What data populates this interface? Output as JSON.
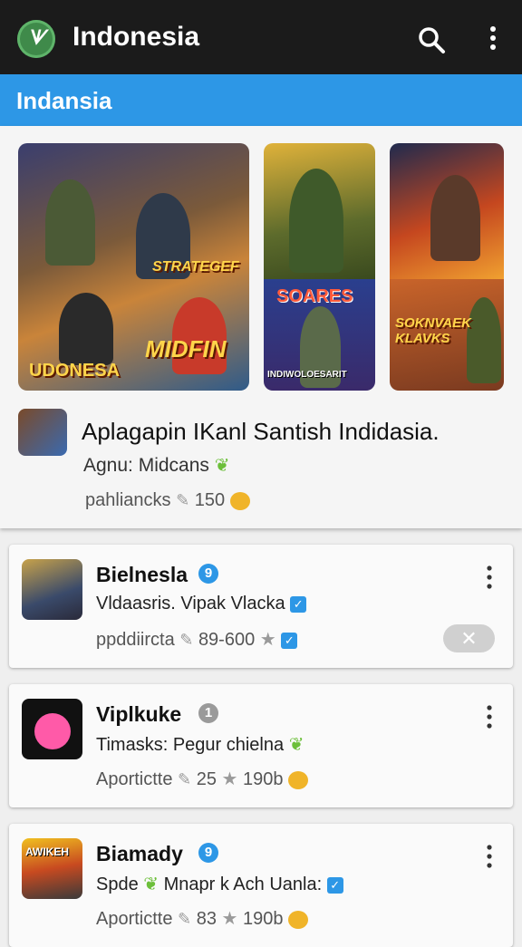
{
  "app_bar": {
    "title": "Indonesia",
    "logo_text": "ᗐ",
    "search_icon": "search-icon",
    "menu_icon": "more-vert-icon"
  },
  "section": {
    "title": "Indansia"
  },
  "featured": {
    "banners": [
      {
        "label_top": "STRATEGEF",
        "label_mid": "MIDFIN",
        "label_bottom": "UDONESA"
      },
      {
        "label_top": "SOARES",
        "label_bottom": "INDIWOLOESARIT"
      },
      {
        "label": "SOKNVAEK KLAVKS"
      }
    ],
    "title": "Aplagapin IKanl Santish Indidasia.",
    "subtitle": "Agnu: Midcans",
    "meta_label": "pahliancks",
    "meta_count": "150"
  },
  "cards": [
    {
      "title": "Bielnesla",
      "badge": "9",
      "subtitle": "Vldaasris. Vipak Vlacka",
      "meta_label": "ppddiircta",
      "meta_value": "89-600",
      "dismiss": "✕"
    },
    {
      "title": "Viplkuke",
      "badge": "1",
      "subtitle": "Timasks: Pegur chielna",
      "meta_label": "Aportictte",
      "meta_value": "25",
      "meta_value2": "190b"
    },
    {
      "title": "Biamady",
      "badge": "9",
      "subtitle_a": "Spde",
      "subtitle_b": "Mnapr k Ach Uanla:",
      "meta_label": "Aportictte",
      "meta_value": "83",
      "meta_value2": "190b",
      "icon_text": "AWIKEH"
    }
  ],
  "colors": {
    "app_bar": "#1b1b1b",
    "accent": "#2d97e6",
    "badge_blue": "#2d97e6",
    "badge_gray": "#9a9a9a",
    "leaf_green": "#6cbf3a"
  }
}
